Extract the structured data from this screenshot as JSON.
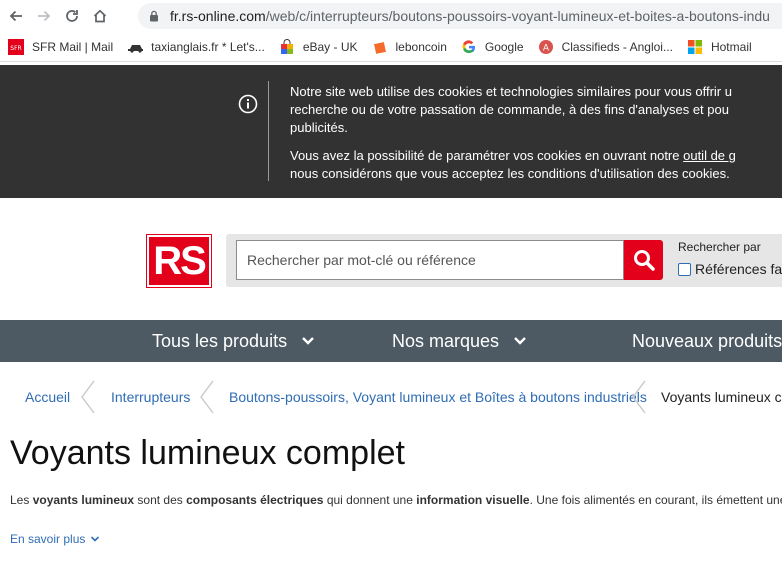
{
  "browser": {
    "url_host": "fr.rs-online.com",
    "url_path": "/web/c/interrupteurs/boutons-poussoirs-voyant-lumineux-et-boites-a-boutons-indu",
    "bookmarks": [
      {
        "label": "SFR Mail | Mail",
        "icon": "sfr-icon"
      },
      {
        "label": "taxianglais.fr * Let's...",
        "icon": "car-icon"
      },
      {
        "label": "eBay - UK",
        "icon": "shopping-bag-icon"
      },
      {
        "label": "leboncoin",
        "icon": "leboncoin-icon"
      },
      {
        "label": "Google",
        "icon": "google-icon"
      },
      {
        "label": "Classifieds - Angloi...",
        "icon": "classifieds-icon"
      },
      {
        "label": "Hotmail",
        "icon": "microsoft-icon"
      }
    ]
  },
  "cookie_banner": {
    "line1": "Notre site web utilise des cookies et technologies similaires pour vous offrir u",
    "line2": "recherche ou de votre passation de commande, à des fins d'analyses et pou",
    "line3": "publicités.",
    "line4_prefix": "Vous avez la possibilité de paramétrer vos cookies en ouvrant notre ",
    "line4_link": "outil de g",
    "line5": "nous considérons que vous acceptez les conditions d'utilisation des cookies."
  },
  "header": {
    "logo_text": "RS",
    "search_placeholder": "Rechercher par mot-clé ou référence",
    "search_by_label": "Rechercher par",
    "references_label": "Références fa"
  },
  "nav": {
    "items": [
      "Tous les produits",
      "Nos marques",
      "Nouveaux produits"
    ]
  },
  "breadcrumb": {
    "items": [
      "Accueil",
      "Interrupteurs",
      "Boutons-poussoirs, Voyant lumineux et Boîtes à boutons industriels"
    ],
    "current": "Voyants lumineux co"
  },
  "page": {
    "title": "Voyants lumineux complet",
    "intro": [
      "Les ",
      "voyants lumineux",
      " sont des ",
      "composants électriques",
      " qui donnent une ",
      "information visuelle",
      ". Une fois alimentés en courant, ils émettent une"
    ],
    "more_label": "En savoir plus"
  },
  "colors": {
    "brand_red": "#e2001a",
    "nav_bg": "#4d5a63",
    "link_blue": "#2f6db5",
    "banner_bg": "#323232"
  }
}
